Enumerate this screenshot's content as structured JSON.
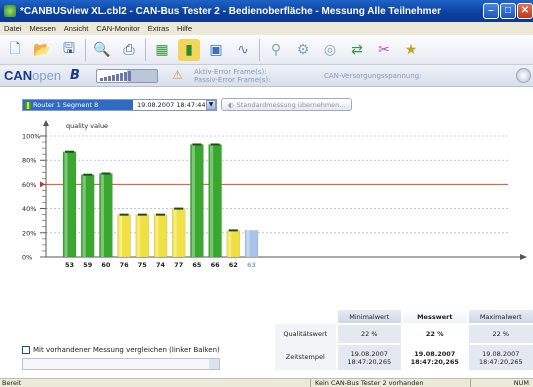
{
  "window": {
    "title": "*CANBUSview XL.cbl2 - CAN-Bus Tester 2 - Bedienoberfläche - Messung Alle Teilnehmer",
    "buttons": [
      "minimize",
      "maximize",
      "close"
    ]
  },
  "menu": [
    "Datei",
    "Messen",
    "Ansicht",
    "CAN-Monitor",
    "Extras",
    "Hilfe"
  ],
  "toolbar": {
    "icons": [
      "new-file-icon",
      "open-folder-icon",
      "save-icon",
      "print-preview-icon",
      "print-icon",
      "network-icon",
      "bar-chart-icon",
      "monitor-icon",
      "oscilloscope-icon",
      "probe-icon",
      "gears-icon",
      "cable-icon",
      "arrows-icon",
      "wrench-icon",
      "graduation-icon"
    ]
  },
  "statusstrip": {
    "logo_can": "CAN",
    "logo_open": "open",
    "error_text_1": "Aktiv-Error Frame(s):",
    "error_text_2": "Passiv-Error Frame(s):",
    "voltage_text": "CAN-Versorgungsspannung:"
  },
  "controls": {
    "segment_selected": "Router 1 Segment 8",
    "segment_date": "19.08.2007 18:47:44",
    "std_button": "Standardmessung übernehmen..."
  },
  "chart_data": {
    "type": "bar",
    "ylabel": "quality value",
    "yticks": [
      "100%",
      "80%",
      "60%",
      "40%",
      "20%",
      "0%"
    ],
    "ylim": [
      0,
      100
    ],
    "threshold": 60,
    "categories": [
      "53",
      "59",
      "60",
      "76",
      "75",
      "74",
      "77",
      "65",
      "66",
      "62",
      "63"
    ],
    "values": [
      87,
      68,
      69,
      35,
      35,
      35,
      40,
      93,
      93,
      22,
      22
    ],
    "colors": [
      "green",
      "green",
      "green",
      "yellow",
      "yellow",
      "yellow",
      "yellow",
      "green",
      "green",
      "yellow",
      "blue"
    ],
    "colorhex": {
      "green": "#3aa830",
      "yellow": "#f1e042",
      "blue": "#a9c4ea",
      "threshold": "#e05030"
    }
  },
  "stats": {
    "headers": [
      "Minimalwert",
      "Messwert",
      "Maximalwert"
    ],
    "rows": [
      {
        "label": "Qualitätswert",
        "values": [
          "22 %",
          "22 %",
          "22 %"
        ]
      },
      {
        "label": "Zeitstempel",
        "values": [
          "19.08.2007\n18:47:20,265",
          "19.08.2007\n18:47:20,265",
          "19.08.2007\n18:47:20,265"
        ]
      }
    ]
  },
  "compare": {
    "label": "Mit vorhandener Messung vergleichen (linker Balken)"
  },
  "statusbar": {
    "left": "Bereit",
    "mid": "Kein CAN-Bus Tester 2 vorhanden",
    "right": "NUM"
  }
}
